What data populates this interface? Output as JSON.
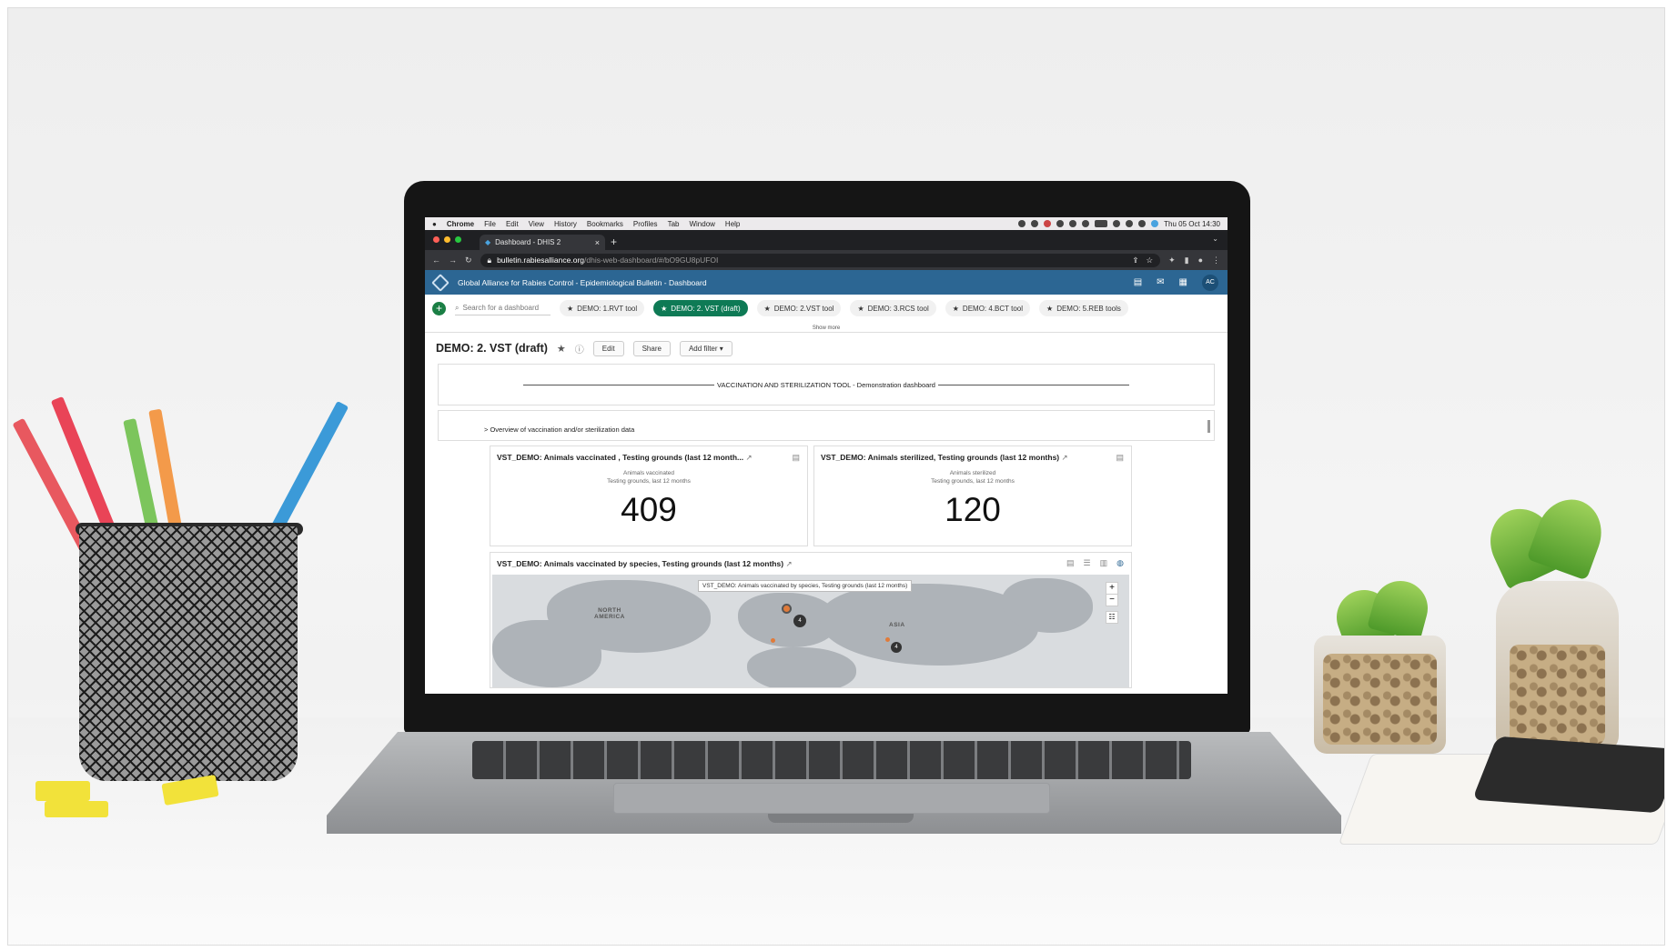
{
  "menubar": {
    "apple": "",
    "items": [
      "Chrome",
      "File",
      "Edit",
      "View",
      "History",
      "Bookmarks",
      "Profiles",
      "Tab",
      "Window",
      "Help"
    ],
    "clock": "Thu 05 Oct 14:30"
  },
  "browser": {
    "tab_title": "Dashboard - DHIS 2",
    "url_host": "bulletin.rabiesalliance.org",
    "url_path": "/dhis-web-dashboard/#/bO9GU8pUFOI"
  },
  "header": {
    "title": "Global Alliance for Rabies Control - Epidemiological Bulletin - Dashboard",
    "avatar": "AC",
    "color": "#2c6693"
  },
  "dashbar": {
    "search_placeholder": "Search for a dashboard",
    "chips": [
      {
        "label": "DEMO: 1.RVT tool",
        "active": false
      },
      {
        "label": "DEMO: 2. VST (draft)",
        "active": true
      },
      {
        "label": "DEMO: 2.VST tool",
        "active": false
      },
      {
        "label": "DEMO: 3.RCS tool",
        "active": false
      },
      {
        "label": "DEMO: 4.BCT tool",
        "active": false
      },
      {
        "label": "DEMO: 5.REB tools",
        "active": false
      }
    ],
    "show_more": "Show more",
    "active_color": "#0e7a55"
  },
  "titlebar": {
    "title": "DEMO: 2. VST (draft)",
    "edit": "Edit",
    "share": "Share",
    "add_filter": "Add filter"
  },
  "items": {
    "heading": "VACCINATION AND STERILIZATION TOOL - Demonstration dashboard",
    "overview": "> Overview of vaccination and/or sterilization data",
    "card1": {
      "title": "VST_DEMO: Animals vaccinated , Testing grounds (last 12 month...",
      "sub1": "Animals vaccinated",
      "sub2": "Testing grounds, last 12 months",
      "value": "409"
    },
    "card2": {
      "title": "VST_DEMO: Animals sterilized, Testing grounds (last 12 months)",
      "sub1": "Animals sterilized",
      "sub2": "Testing grounds, last 12 months",
      "value": "120"
    },
    "map": {
      "title": "VST_DEMO: Animals vaccinated by species, Testing grounds (last 12 months)",
      "tooltip": "VST_DEMO: Animals vaccinated by species, Testing grounds (last 12 months)",
      "label_na1": "NORTH",
      "label_na2": "AMERICA",
      "label_asia": "ASIA",
      "cluster1": "4",
      "cluster2": "4"
    }
  }
}
